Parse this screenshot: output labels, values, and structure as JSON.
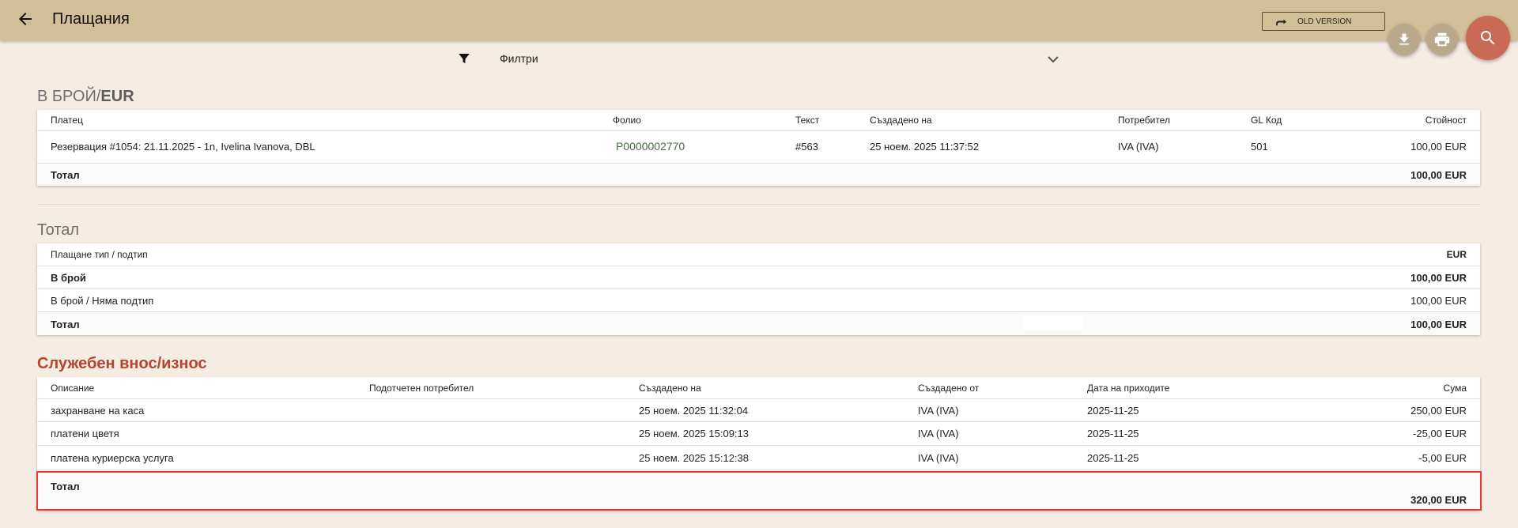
{
  "header": {
    "title": "Плащания",
    "old_version_label": "OLD VERSION"
  },
  "filters": {
    "label": "Филтри"
  },
  "cash_section": {
    "title_part1": "В БРОЙ/",
    "title_part2": "EUR",
    "columns": [
      "Платец",
      "Фолио",
      "Текст",
      "Създадено на",
      "Потребител",
      "GL Код",
      "Стойност"
    ],
    "rows": [
      {
        "payer": "Резервация #1054: 21.11.2025 - 1n, Ivelina Ivanova, DBL",
        "folio": "P0000002770",
        "text": "#563",
        "created": "25 ноем. 2025 11:37:52",
        "user": "IVA (IVA)",
        "gl": "501",
        "value": "100,00 EUR"
      }
    ],
    "total_label": "Тотал",
    "total_value": "100,00 EUR"
  },
  "total_section": {
    "title": "Тотал",
    "header_label": "Плащане тип / подтип",
    "header_currency": "EUR",
    "rows": [
      {
        "label": "В брой",
        "value": "100,00 EUR",
        "bold": true
      },
      {
        "label": "В брой / Няма подтип",
        "value": "100,00 EUR",
        "bold": false
      }
    ],
    "total_label": "Тотал",
    "total_value": "100,00 EUR"
  },
  "service_section": {
    "title": "Служебен внос/износ",
    "columns": [
      "Описание",
      "Подотчетен потребител",
      "Създадено на",
      "Създадено от",
      "Дата на приходите",
      "Сума"
    ],
    "rows": [
      {
        "description": "захранване на каса",
        "user": "",
        "created": "25 ноем. 2025 11:32:04",
        "created_by": "IVA (IVA)",
        "date": "2025-11-25",
        "amount": "250,00 EUR"
      },
      {
        "description": "платени цветя",
        "user": "",
        "created": "25 ноем. 2025 15:09:13",
        "created_by": "IVA (IVA)",
        "date": "2025-11-25",
        "amount": "-25,00 EUR"
      },
      {
        "description": "платена куриерска услуга",
        "user": "",
        "created": "25 ноем. 2025 15:12:38",
        "created_by": "IVA (IVA)",
        "date": "2025-11-25",
        "amount": "-5,00 EUR"
      }
    ],
    "total_label": "Тотал",
    "total_value": "320,00 EUR"
  }
}
